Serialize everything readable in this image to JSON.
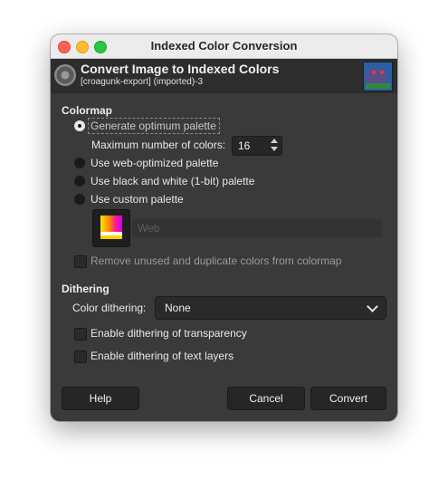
{
  "window": {
    "title": "Indexed Color Conversion"
  },
  "header": {
    "title": "Convert Image to Indexed Colors",
    "subtitle": "[croagunk-export] (imported)-3"
  },
  "colormap": {
    "section_label": "Colormap",
    "options": [
      {
        "label": "Generate optimum palette",
        "selected": true
      },
      {
        "label": "Use web-optimized palette",
        "selected": false
      },
      {
        "label": "Use black and white (1-bit) palette",
        "selected": false
      },
      {
        "label": "Use custom palette",
        "selected": false
      }
    ],
    "max_colors_label": "Maximum number of colors:",
    "max_colors_value": "16",
    "custom_palette_name": "Web",
    "remove_unused_label": "Remove unused and duplicate colors from colormap",
    "remove_unused_checked": false
  },
  "dithering": {
    "section_label": "Dithering",
    "color_dithering_label": "Color dithering:",
    "color_dithering_value": "None",
    "transparency_label": "Enable dithering of transparency",
    "transparency_checked": false,
    "text_layers_label": "Enable dithering of text layers",
    "text_layers_checked": false
  },
  "buttons": {
    "help": "Help",
    "cancel": "Cancel",
    "convert": "Convert"
  },
  "colors": {
    "window_bg": "#3a3a3a",
    "header_bg": "#2d2d2d",
    "close": "#fe5f57",
    "minimize": "#febc2e",
    "maximize": "#28c840"
  }
}
